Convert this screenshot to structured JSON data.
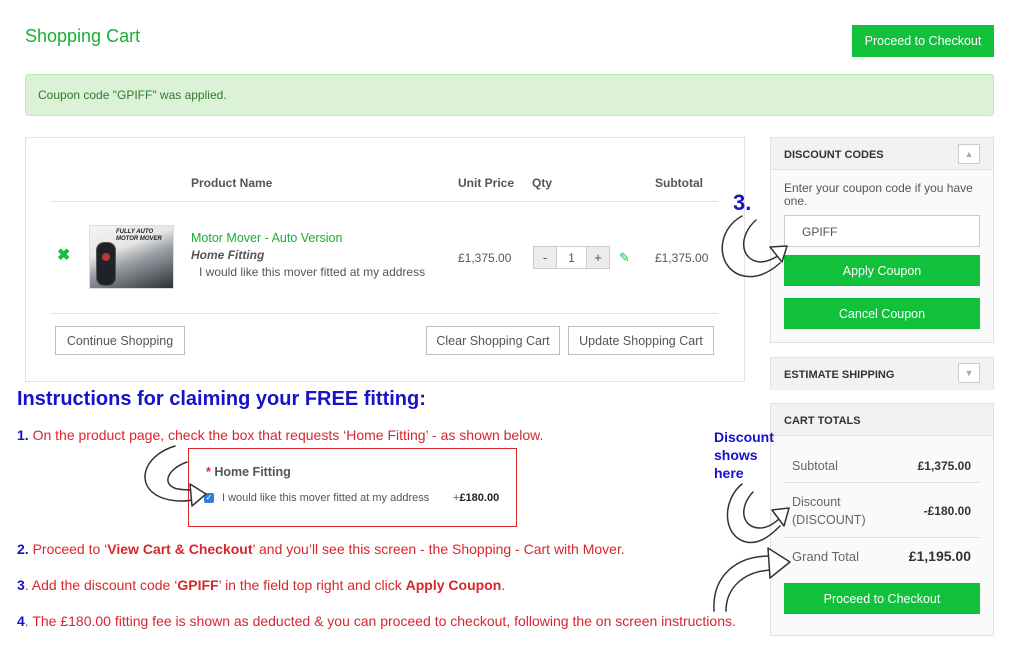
{
  "page": {
    "title": "Shopping Cart",
    "top_checkout_label": "Proceed to Checkout"
  },
  "notice": {
    "message": "Coupon code \"GPIFF\" was applied."
  },
  "cart": {
    "columns": [
      "Product Name",
      "Unit Price",
      "Qty",
      "Subtotal"
    ],
    "item": {
      "remove_icon": "✖",
      "thumbnail_text": "FULLY AUTO\nMOTOR MOVER",
      "name": "Motor Mover - Auto Version",
      "option_label": "Home Fitting",
      "option_value": "I would like this mover fitted at my address",
      "unit_price": "£1,375.00",
      "qty_minus": "-",
      "qty": "1",
      "qty_plus": "+",
      "edit_icon": "✎",
      "subtotal": "£1,375.00"
    },
    "continue_label": "Continue Shopping",
    "clear_label": "Clear Shopping Cart",
    "update_label": "Update Shopping Cart"
  },
  "discount": {
    "heading": "DISCOUNT CODES",
    "toggle_icon": "▲",
    "hint": "Enter your coupon code if you have one.",
    "code_value": "GPIFF",
    "apply_label": "Apply Coupon",
    "cancel_label": "Cancel Coupon"
  },
  "shipping": {
    "heading": "ESTIMATE SHIPPING",
    "toggle_icon": "▼"
  },
  "totals": {
    "heading": "CART TOTALS",
    "subtotal_label": "Subtotal",
    "subtotal_value": "£1,375.00",
    "discount_label_line1": "Discount",
    "discount_label_line2": "(DISCOUNT)",
    "discount_value": "-£180.00",
    "grand_label": "Grand Total",
    "grand_value": "£1,195.00",
    "checkout_label": "Proceed to Checkout"
  },
  "instructions": {
    "title": "Instructions for claiming your FREE fitting:",
    "step1": {
      "num": "1.",
      "text": " On the product page, check the box that requests ‘Home Fitting’ - as shown below."
    },
    "step2": {
      "num": "2.",
      "pre": " Proceed to ‘",
      "bold": "View Cart & Checkout",
      "post": "’ and you’ll see this screen - the Shopping - Cart with Mover."
    },
    "step3": {
      "num": "3",
      "pre": ". Add the discount code  ‘",
      "bold1": "GPIFF",
      "mid": "’ in the field top right and click ",
      "bold2": "Apply Coupon",
      "post": "."
    },
    "step4": {
      "num": "4",
      "text": ". The £180.00 fitting fee is shown as deducted & you can proceed to checkout, following the on screen instructions."
    }
  },
  "demo_option": {
    "star": "*",
    "label": "Home Fitting",
    "checkbox_icon": "✓",
    "text": "I would like this mover fitted at my address",
    "price_prefix": "+",
    "price": "£180.00"
  },
  "annotations": {
    "step_marker": "3.",
    "discount_note_line1": "Discount",
    "discount_note_line2": "shows",
    "discount_note_line3": "here"
  }
}
